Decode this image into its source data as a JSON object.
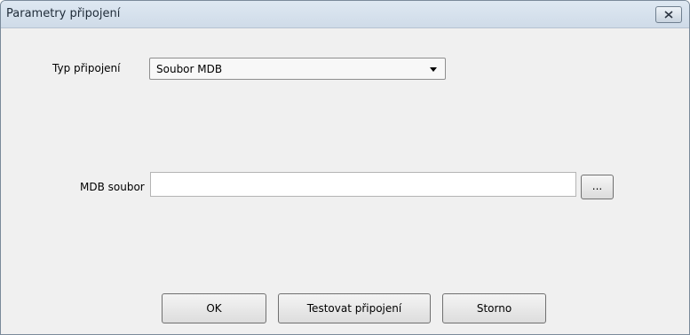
{
  "window": {
    "title": "Parametry připojení"
  },
  "form": {
    "connection_type_label": "Typ připojení",
    "connection_type_value": "Soubor MDB",
    "mdb_file_label": "MDB soubor",
    "mdb_file_value": "",
    "browse_label": "..."
  },
  "buttons": {
    "ok_label": "OK",
    "test_label": "Testovat připojení",
    "cancel_label": "Storno"
  }
}
